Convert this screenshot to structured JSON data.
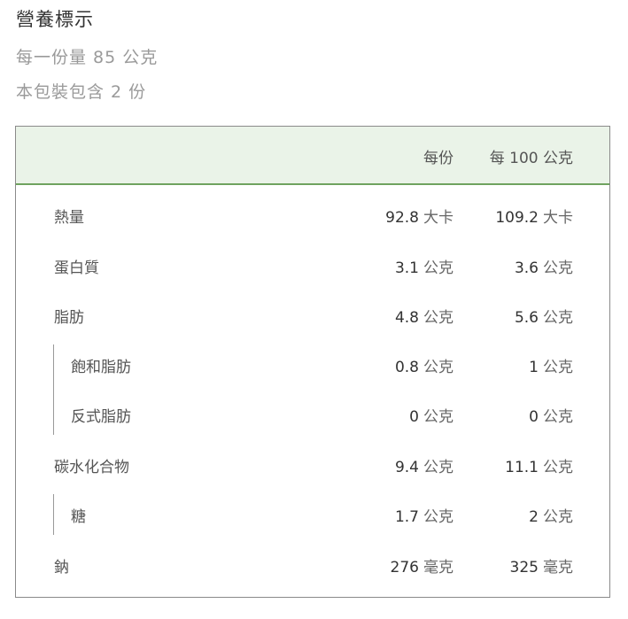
{
  "header": {
    "title": "營養標示",
    "serving_size": "每一份量 85 公克",
    "servings_per_pack": "本包裝包含 2 份"
  },
  "table": {
    "columns": [
      "每份",
      "每 100 公克"
    ],
    "rows": [
      {
        "label": "熱量",
        "per_serving": "92.8",
        "per_serving_unit": "大卡",
        "per_100g": "109.2",
        "per_100g_unit": "大卡"
      },
      {
        "label": "蛋白質",
        "per_serving": "3.1",
        "per_serving_unit": "公克",
        "per_100g": "3.6",
        "per_100g_unit": "公克"
      },
      {
        "label": "脂肪",
        "per_serving": "4.8",
        "per_serving_unit": "公克",
        "per_100g": "5.6",
        "per_100g_unit": "公克"
      },
      {
        "label": "飽和脂肪",
        "per_serving": "0.8",
        "per_serving_unit": "公克",
        "per_100g": "1",
        "per_100g_unit": "公克"
      },
      {
        "label": "反式脂肪",
        "per_serving": "0",
        "per_serving_unit": "公克",
        "per_100g": "0",
        "per_100g_unit": "公克"
      },
      {
        "label": "碳水化合物",
        "per_serving": "9.4",
        "per_serving_unit": "公克",
        "per_100g": "11.1",
        "per_100g_unit": "公克"
      },
      {
        "label": "糖",
        "per_serving": "1.7",
        "per_serving_unit": "公克",
        "per_100g": "2",
        "per_100g_unit": "公克"
      },
      {
        "label": "鈉",
        "per_serving": "276",
        "per_serving_unit": "毫克",
        "per_100g": "325",
        "per_100g_unit": "毫克"
      }
    ]
  }
}
